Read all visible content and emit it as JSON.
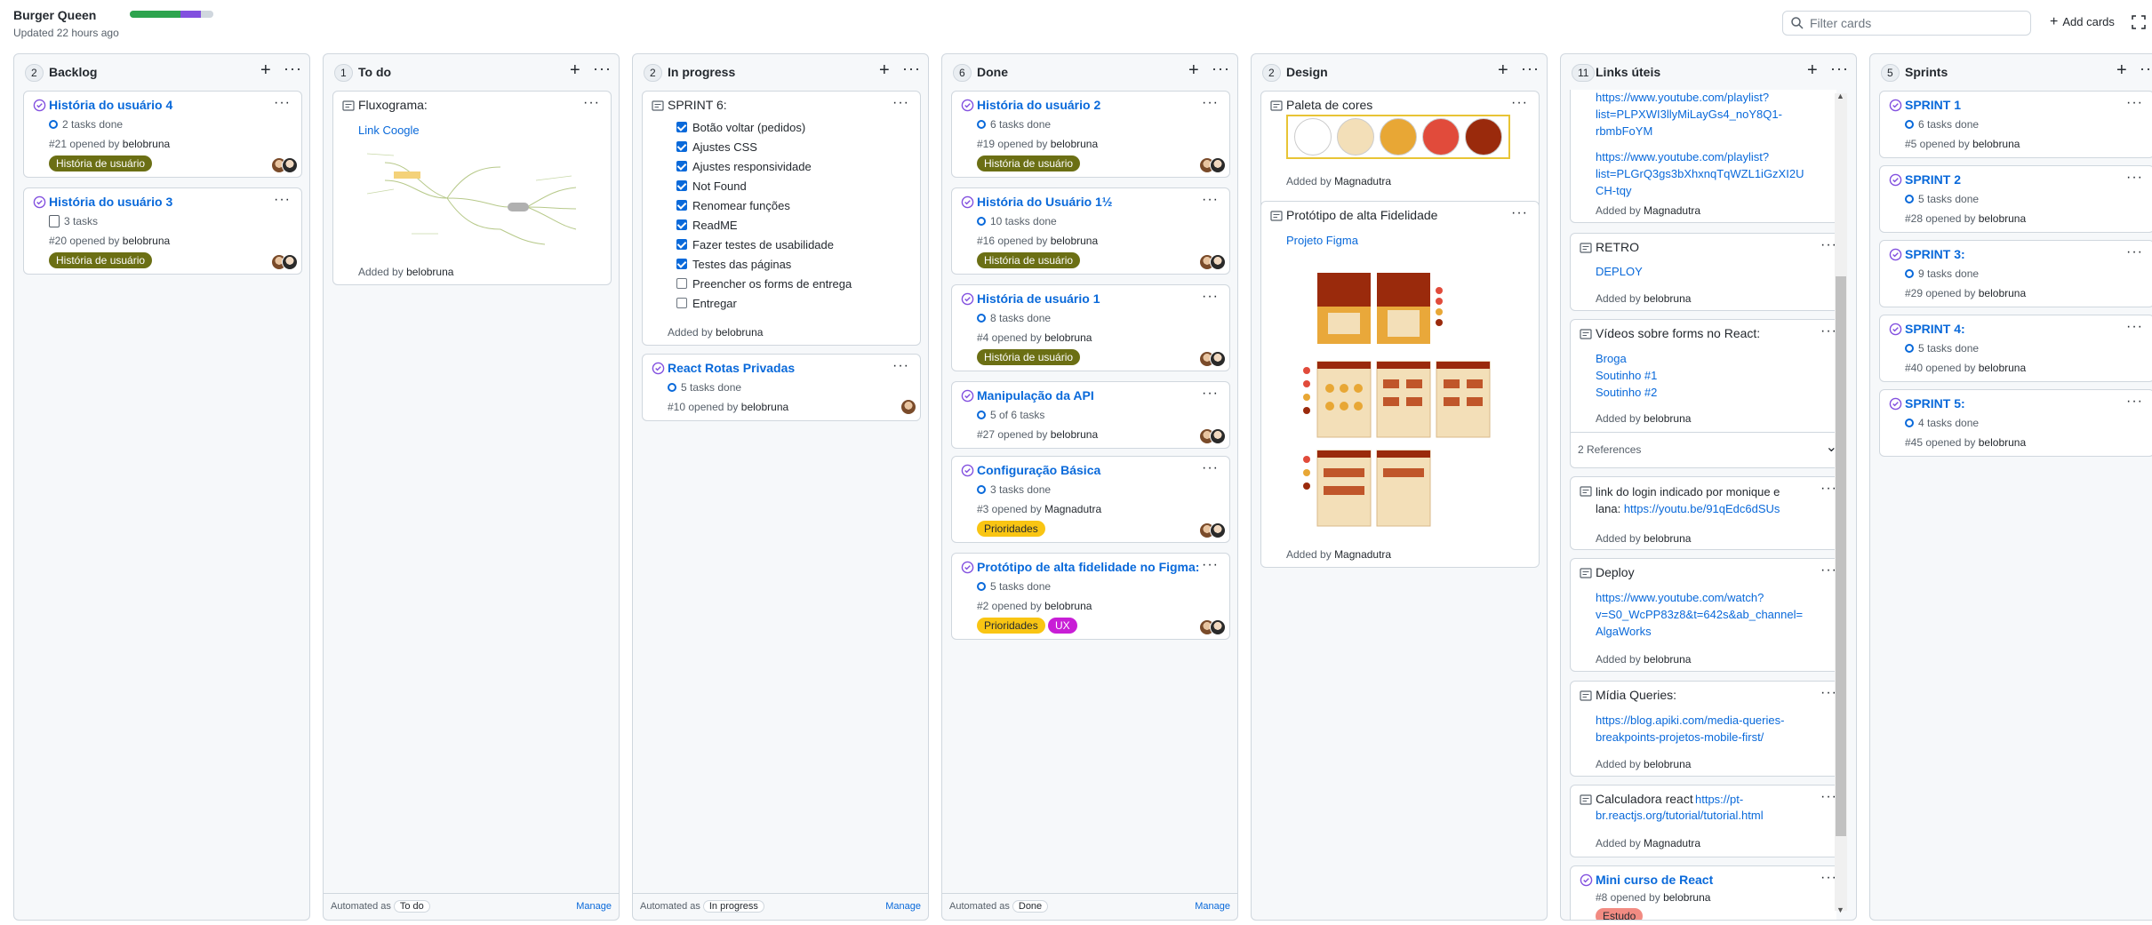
{
  "project": {
    "title": "Burger Queen",
    "updated": "Updated 22 hours ago",
    "progress": [
      {
        "color": "#2da44e",
        "fraction": 0.61
      },
      {
        "color": "#8250df",
        "fraction": 0.24
      },
      {
        "color": "#d0d7de",
        "fraction": 0.15
      }
    ]
  },
  "toolbar": {
    "filter_placeholder": "Filter cards",
    "add_cards": "Add cards"
  },
  "colors": {
    "link": "#0969da",
    "open_issue": "#8250df",
    "label_historia": "#6b6f14",
    "label_prioridades": "#f9c513",
    "label_ux": "#c81ed6",
    "label_estudo": "#f28b82"
  },
  "columns": [
    {
      "count": "2",
      "title": "Backlog",
      "cards": [
        {
          "title": "História do usuário 4",
          "tasks": "2 tasks done",
          "num": "#21",
          "opened": "opened by",
          "user": "belobruna",
          "label": "História de usuário"
        },
        {
          "title": "História do usuário 3",
          "tasks": "3 tasks",
          "num": "#20",
          "opened": "opened by",
          "user": "belobruna",
          "label": "História de usuário"
        }
      ]
    },
    {
      "count": "1",
      "title": "To do",
      "cards": [
        {
          "title": "Fluxograma:",
          "link": "Link Coogle",
          "added": "Added by",
          "user": "belobruna"
        }
      ],
      "automated": "Automated as",
      "automated_value": "To do",
      "manage": "Manage"
    },
    {
      "count": "2",
      "title": "In progress",
      "cards": [
        {
          "title": "SPRINT 6:",
          "checklist": [
            {
              "text": "Botão voltar (pedidos)",
              "checked": true
            },
            {
              "text": "Ajustes CSS",
              "checked": true
            },
            {
              "text": "Ajustes responsividade",
              "checked": true
            },
            {
              "text": "Not Found",
              "checked": true
            },
            {
              "text": "Renomear funções",
              "checked": true
            },
            {
              "text": "ReadME",
              "checked": true
            },
            {
              "text": "Fazer testes de usabilidade",
              "checked": true
            },
            {
              "text": "Testes das páginas",
              "checked": true
            },
            {
              "text": "Preencher os forms de entrega",
              "checked": false
            },
            {
              "text": "Entregar",
              "checked": false
            }
          ],
          "added": "Added by",
          "user": "belobruna"
        },
        {
          "title": "React Rotas Privadas",
          "tasks": "5 tasks done",
          "num": "#10",
          "opened": "opened by",
          "user": "belobruna"
        }
      ],
      "automated": "Automated as",
      "automated_value": "In progress",
      "manage": "Manage"
    },
    {
      "count": "6",
      "title": "Done",
      "cards": [
        {
          "title": "História do usuário 2",
          "tasks": "6 tasks done",
          "num": "#19",
          "opened": "opened by",
          "user": "belobruna",
          "label": "História de usuário"
        },
        {
          "title": "História do Usuário 1½",
          "tasks": "10 tasks done",
          "num": "#16",
          "opened": "opened by",
          "user": "belobruna",
          "label": "História de usuário"
        },
        {
          "title": "História de usuário 1",
          "tasks": "8 tasks done",
          "num": "#4",
          "opened": "opened by",
          "user": "belobruna",
          "label": "História de usuário"
        },
        {
          "title": "Manipulação da API",
          "tasks": "5 of 6 tasks",
          "num": "#27",
          "opened": "opened by",
          "user": "belobruna"
        },
        {
          "title": "Configuração Básica",
          "tasks": "3 tasks done",
          "num": "#3",
          "opened": "opened by",
          "user": "Magnadutra",
          "label": "Prioridades"
        },
        {
          "title": "Protótipo de alta fidelidade no Figma:",
          "tasks": "5 tasks done",
          "num": "#2",
          "opened": "opened by",
          "user": "belobruna",
          "label": "Prioridades",
          "label2": "UX"
        }
      ],
      "automated": "Automated as",
      "automated_value": "Done",
      "manage": "Manage"
    },
    {
      "count": "2",
      "title": "Design",
      "cards": [
        {
          "title": "Paleta de cores",
          "palette": [
            "#ffffff",
            "#f3dfb8",
            "#e8a735",
            "#e14b3b",
            "#9a2a0c"
          ],
          "added": "Added by",
          "user": "Magnadutra"
        },
        {
          "title": "Protótipo de alta Fidelidade",
          "link": "Projeto Figma",
          "added": "Added by",
          "user": "Magnadutra"
        }
      ]
    },
    {
      "count": "11",
      "title": "Links úteis",
      "cards": [
        {
          "link": "https://www.youtube.com/playlist?list=PLPXWI3llyMiLayGs4_noY8Q1-rbmbFoYM",
          "link_lines": [
            "https://www.youtube.com/playlist?",
            "list=PLPXWI3llyMiLayGs4_noY8Q1-",
            "rbmbFoYM"
          ],
          "link2_lines": [
            "https://www.youtube.com/playlist?",
            "list=PLGrQ3gs3bXhxnqTqWZL1iGzXI2U",
            "CH-tqy"
          ],
          "added": "Added by",
          "user": "Magnadutra"
        },
        {
          "title": "RETRO",
          "link": "DEPLOY",
          "added": "Added by",
          "user": "belobruna"
        },
        {
          "title": "Vídeos sobre forms no React:",
          "links": [
            "Broga",
            "Soutinho #1",
            "Soutinho #2"
          ],
          "added": "Added by",
          "user": "belobruna",
          "references": "2 References"
        },
        {
          "title_lines": [
            "link do login indicado por monique e",
            "lana: "
          ],
          "link": "https://youtu.be/91qEdc6dSUs",
          "added": "Added by",
          "user": "belobruna"
        },
        {
          "title": "Deploy",
          "link_lines": [
            "https://www.youtube.com/watch?",
            "v=S0_WcPP83z8&t=642s&ab_channel=",
            "AlgaWorks"
          ],
          "added": "Added by",
          "user": "belobruna"
        },
        {
          "title": "Mídia Queries:",
          "link_lines": [
            "https://blog.apiki.com/media-queries-",
            "breakpoints-projetos-mobile-first/"
          ],
          "added": "Added by",
          "user": "belobruna"
        },
        {
          "title": "Calculadora react",
          "link_lines": [
            "https://pt-",
            "br.reactjs.org/tutorial/tutorial.html"
          ],
          "added": "Added by",
          "user": "Magnadutra"
        },
        {
          "title": "Mini curso de React",
          "num": "#8",
          "opened": "opened by",
          "user": "belobruna",
          "label": "Estudo"
        }
      ]
    },
    {
      "count": "5",
      "title": "Sprints",
      "cards": [
        {
          "title": "SPRINT 1",
          "tasks": "6 tasks done",
          "num": "#5",
          "opened": "opened by",
          "user": "belobruna"
        },
        {
          "title": "SPRINT 2",
          "tasks": "5 tasks done",
          "num": "#28",
          "opened": "opened by",
          "user": "belobruna"
        },
        {
          "title": "SPRINT 3:",
          "tasks": "9 tasks done",
          "num": "#29",
          "opened": "opened by",
          "user": "belobruna"
        },
        {
          "title": "SPRINT 4:",
          "tasks": "5 tasks done",
          "num": "#40",
          "opened": "opened by",
          "user": "belobruna"
        },
        {
          "title": "SPRINT 5:",
          "tasks": "4 tasks done",
          "num": "#45",
          "opened": "opened by",
          "user": "belobruna"
        }
      ]
    }
  ]
}
